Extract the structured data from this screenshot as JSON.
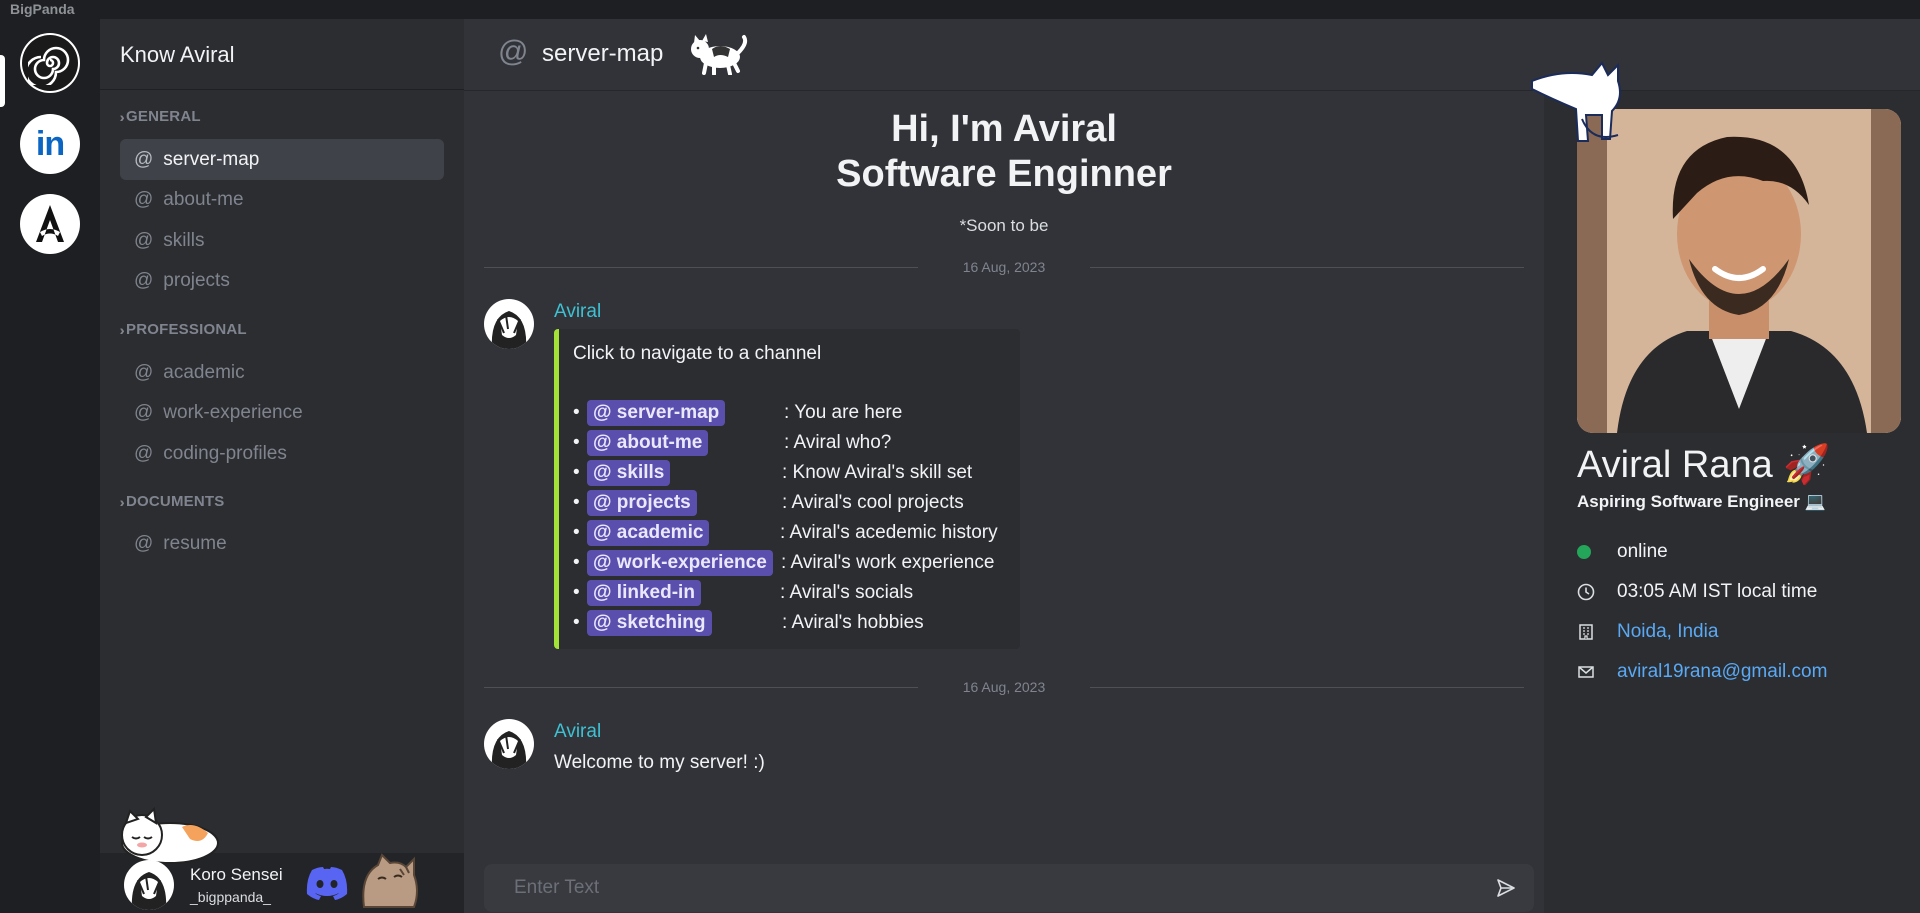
{
  "app": {
    "brand": "BigPanda"
  },
  "rail": {
    "servers": [
      {
        "name": "bigpanda-server-icon"
      },
      {
        "name": "linkedin-icon",
        "text": "in"
      },
      {
        "name": "assassins-creed-icon"
      }
    ]
  },
  "sidebar": {
    "title": "Know Aviral",
    "categories": [
      {
        "label": "GENERAL",
        "channels": [
          "server-map",
          "about-me",
          "skills",
          "projects"
        ]
      },
      {
        "label": "PROFESSIONAL",
        "channels": [
          "academic",
          "work-experience",
          "coding-profiles"
        ]
      },
      {
        "label": "DOCUMENTS",
        "channels": [
          "resume"
        ]
      }
    ],
    "active_channel": "server-map"
  },
  "user": {
    "name": "Koro Sensei",
    "handle": "_bigppanda_"
  },
  "header": {
    "at": "@",
    "channel": "server-map"
  },
  "chat": {
    "hero_line1": "Hi, I'm Aviral",
    "hero_line2": "Software Enginner",
    "hero_sub": "*Soon to be",
    "date1": "16 Aug, 2023",
    "date2": "16 Aug, 2023",
    "message1": {
      "author": "Aviral",
      "embed_title": "Click to navigate to a channel",
      "items": [
        {
          "mention": "@ server-map",
          "desc": ": You are here"
        },
        {
          "mention": "@ about-me",
          "desc": ": Aviral who?"
        },
        {
          "mention": "@ skills",
          "desc": ": Know Aviral's skill set"
        },
        {
          "mention": "@ projects",
          "desc": ": Aviral's cool projects"
        },
        {
          "mention": "@ academic",
          "desc": ": Aviral's acedemic history"
        },
        {
          "mention": "@ work-experience",
          "desc": ": Aviral's work experience"
        },
        {
          "mention": "@ linked-in",
          "desc": ": Aviral's socials"
        },
        {
          "mention": "@ sketching",
          "desc": ": Aviral's hobbies"
        }
      ]
    },
    "message2": {
      "author": "Aviral",
      "text": "Welcome to my server! :)"
    },
    "input_placeholder": "Enter Text"
  },
  "profile": {
    "name": "Aviral Rana 🚀",
    "subtitle": "Aspiring Software Engineer 💻",
    "status": "online",
    "time": "03:05 AM IST local time",
    "location": "Noida, India",
    "email": "aviral19rana@gmail.com"
  },
  "colors": {
    "accent_link": "#5aa9f5",
    "author": "#3ec1d3",
    "mention_bg": "#5b4fad",
    "embed_bar": "#a5e238",
    "online": "#23a55a"
  }
}
